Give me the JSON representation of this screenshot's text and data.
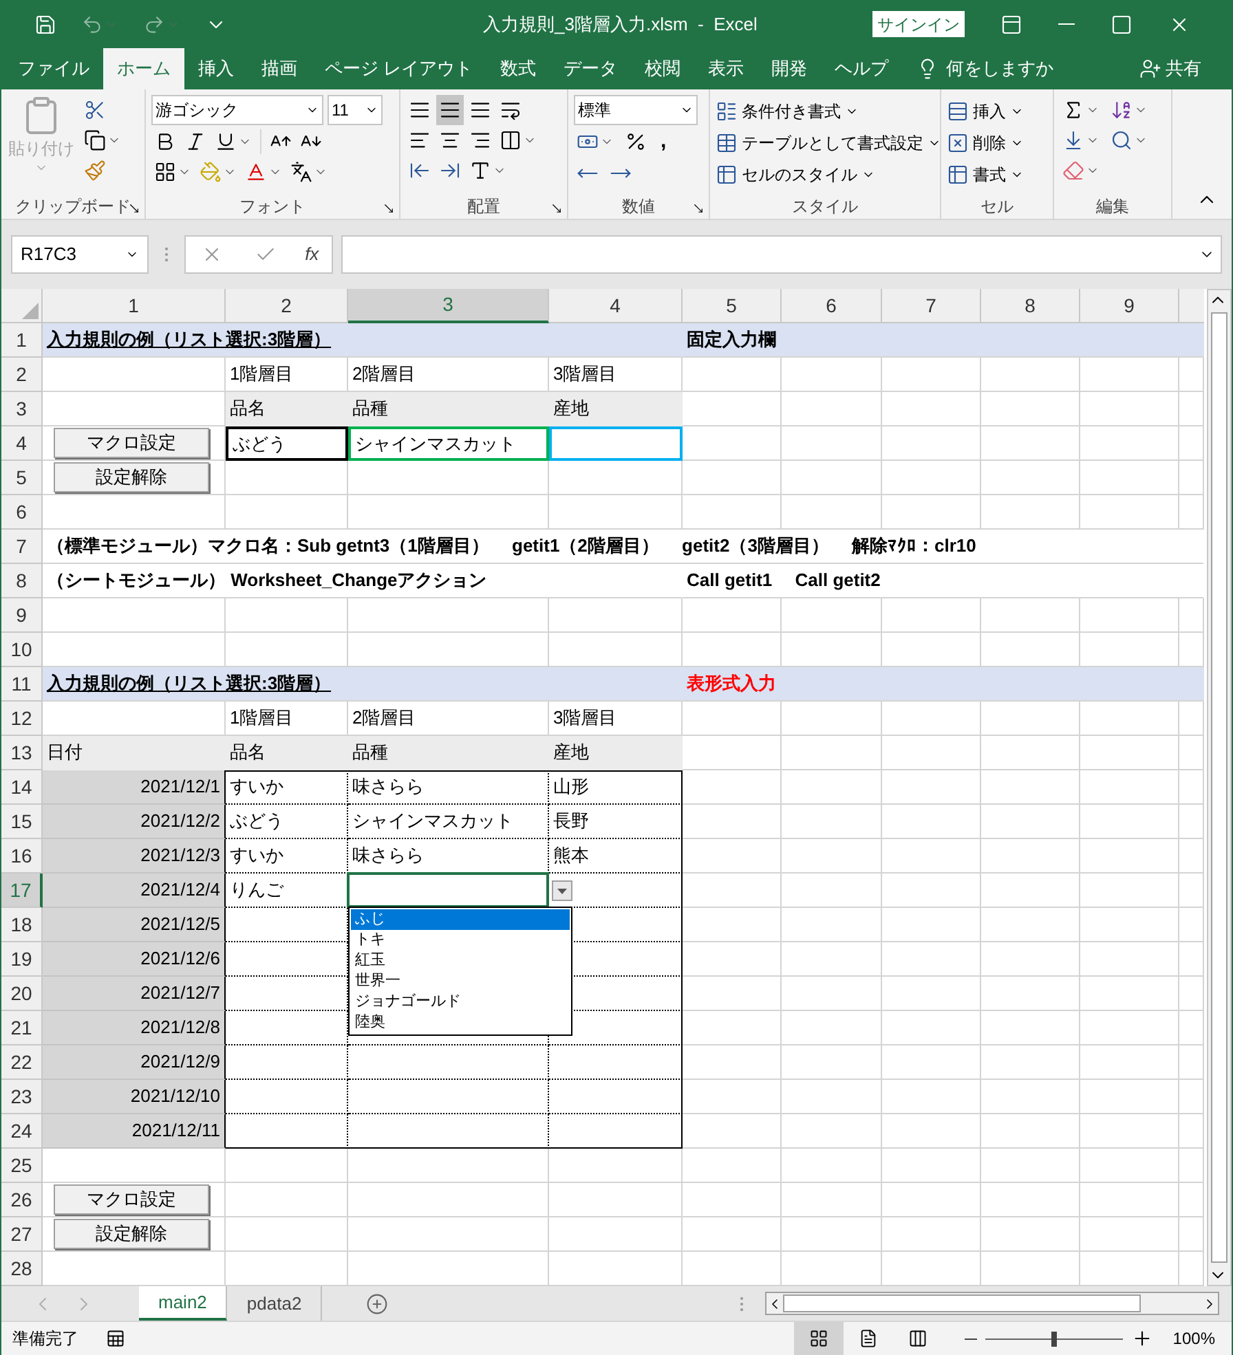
{
  "window": {
    "title": "入力規則_3階層入力.xlsm  -  Excel",
    "sign_in": "サインイン"
  },
  "menu_tabs": [
    {
      "label": "ファイル",
      "selected": false
    },
    {
      "label": "ホーム",
      "selected": true
    },
    {
      "label": "挿入",
      "selected": false
    },
    {
      "label": "描画",
      "selected": false
    },
    {
      "label": "ページ レイアウト",
      "selected": false
    },
    {
      "label": "数式",
      "selected": false
    },
    {
      "label": "データ",
      "selected": false
    },
    {
      "label": "校閲",
      "selected": false
    },
    {
      "label": "表示",
      "selected": false
    },
    {
      "label": "開発",
      "selected": false
    },
    {
      "label": "ヘルプ",
      "selected": false
    }
  ],
  "tell_me": "何をしますか",
  "share": "共有",
  "ribbon": {
    "clipboard": {
      "label": "クリップボード",
      "paste": "貼り付け",
      "paste_disabled": true,
      "launcher": true
    },
    "font": {
      "label": "フォント",
      "font_name": "游ゴシック",
      "font_size": "11",
      "launcher": true
    },
    "alignment": {
      "label": "配置",
      "launcher": true
    },
    "number": {
      "label": "数値",
      "format": "標準",
      "comma": ",",
      "launcher": true
    },
    "styles": {
      "label": "スタイル",
      "items": [
        "条件付き書式",
        "テーブルとして書式設定",
        "セルのスタイル"
      ]
    },
    "cells": {
      "label": "セル",
      "items": [
        "挿入",
        "削除",
        "書式"
      ]
    },
    "editing": {
      "label": "編集"
    }
  },
  "formula_bar": {
    "name_box": "R17C3",
    "fx": "fx"
  },
  "columns": [
    {
      "label": "1",
      "selected": false
    },
    {
      "label": "2",
      "selected": false
    },
    {
      "label": "3",
      "selected": true
    },
    {
      "label": "4",
      "selected": false
    },
    {
      "label": "5",
      "selected": false
    },
    {
      "label": "6",
      "selected": false
    },
    {
      "label": "7",
      "selected": false
    },
    {
      "label": "8",
      "selected": false
    },
    {
      "label": "9",
      "selected": false
    }
  ],
  "rows": [
    {
      "number": "1",
      "band": true,
      "selected": false,
      "cells": [
        {
          "kind": "title",
          "text": "入力規則の例（リスト選択:3階層）"
        },
        null,
        null,
        null,
        {
          "kind": "bold",
          "text": "固定入力欄"
        }
      ]
    },
    {
      "number": "2",
      "band": false,
      "selected": false,
      "cells": [
        null,
        {
          "kind": "text",
          "text": "1階層目"
        },
        {
          "kind": "text",
          "text": "2階層目"
        },
        {
          "kind": "text",
          "text": "3階層目"
        }
      ]
    },
    {
      "number": "3",
      "band": false,
      "selected": false,
      "cells": [
        null,
        {
          "kind": "heading",
          "text": "品名"
        },
        {
          "kind": "heading",
          "text": "品種"
        },
        {
          "kind": "heading",
          "text": "産地"
        }
      ]
    },
    {
      "number": "4",
      "band": false,
      "selected": false,
      "cells": [
        {
          "kind": "button",
          "text": "マクロ設定"
        },
        {
          "kind": "entry",
          "text": "ぶどう",
          "color": "#000000"
        },
        {
          "kind": "entry",
          "text": "シャインマスカット",
          "color": "#00b050"
        },
        {
          "kind": "entry",
          "color": "#00b0f0"
        }
      ]
    },
    {
      "number": "5",
      "band": false,
      "selected": false,
      "cells": [
        {
          "kind": "button",
          "text": "設定解除"
        }
      ]
    },
    {
      "number": "6",
      "band": false,
      "selected": false,
      "cells": []
    },
    {
      "number": "7",
      "band": false,
      "selected": false,
      "cells": [
        {
          "kind": "bold",
          "text": "（標準モジュール）マクロ名：Sub getnt3（1階層目）　 getit1（2階層目）　 getit2（3階層目）　 解除ﾏｸﾛ：clr10"
        }
      ]
    },
    {
      "number": "8",
      "band": false,
      "selected": false,
      "cells": [
        {
          "kind": "bold",
          "text": "（シートモジュール） Worksheet_Changeアクション"
        },
        null,
        null,
        null,
        {
          "kind": "bold",
          "text": "Call getit1　 Call getit2"
        }
      ]
    },
    {
      "number": "9",
      "band": false,
      "selected": false,
      "cells": []
    },
    {
      "number": "10",
      "band": false,
      "selected": false,
      "cells": []
    },
    {
      "number": "11",
      "band": true,
      "selected": false,
      "cells": [
        {
          "kind": "title",
          "text": "入力規則の例（リスト選択:3階層）"
        },
        null,
        null,
        null,
        {
          "kind": "alert",
          "text": "表形式入力"
        }
      ]
    },
    {
      "number": "12",
      "band": false,
      "selected": false,
      "cells": [
        null,
        {
          "kind": "text",
          "text": "1階層目"
        },
        {
          "kind": "text",
          "text": "2階層目"
        },
        {
          "kind": "text",
          "text": "3階層目"
        }
      ]
    },
    {
      "number": "13",
      "band": false,
      "selected": false,
      "cells": [
        {
          "kind": "heading",
          "text": "日付"
        },
        {
          "kind": "heading",
          "text": "品名"
        },
        {
          "kind": "heading",
          "text": "品種"
        },
        {
          "kind": "heading",
          "text": "産地"
        }
      ]
    },
    {
      "number": "14",
      "band": false,
      "selected": false,
      "cells": [
        {
          "kind": "date",
          "text": "2021/12/1"
        },
        {
          "kind": "table",
          "text": "すいか"
        },
        {
          "kind": "table",
          "text": "味さらら"
        },
        {
          "kind": "table",
          "text": "山形"
        }
      ]
    },
    {
      "number": "15",
      "band": false,
      "selected": false,
      "cells": [
        {
          "kind": "date",
          "text": "2021/12/2"
        },
        {
          "kind": "table",
          "text": "ぶどう"
        },
        {
          "kind": "table",
          "text": "シャインマスカット"
        },
        {
          "kind": "table",
          "text": "長野"
        }
      ]
    },
    {
      "number": "16",
      "band": false,
      "selected": false,
      "cells": [
        {
          "kind": "date",
          "text": "2021/12/3"
        },
        {
          "kind": "table",
          "text": "すいか"
        },
        {
          "kind": "table",
          "text": "味さらら"
        },
        {
          "kind": "table",
          "text": "熊本"
        }
      ]
    },
    {
      "number": "17",
      "band": false,
      "selected": true,
      "cells": [
        {
          "kind": "date",
          "text": "2021/12/4"
        },
        {
          "kind": "table",
          "text": "りんご"
        },
        {
          "kind": "active"
        },
        {
          "kind": "table"
        }
      ]
    },
    {
      "number": "18",
      "band": false,
      "selected": false,
      "cells": [
        {
          "kind": "date",
          "text": "2021/12/5"
        },
        {
          "kind": "table"
        },
        {
          "kind": "covered"
        },
        {
          "kind": "table"
        }
      ]
    },
    {
      "number": "19",
      "band": false,
      "selected": false,
      "cells": [
        {
          "kind": "date",
          "text": "2021/12/6"
        },
        {
          "kind": "table"
        },
        {
          "kind": "covered"
        },
        {
          "kind": "table"
        }
      ]
    },
    {
      "number": "20",
      "band": false,
      "selected": false,
      "cells": [
        {
          "kind": "date",
          "text": "2021/12/7"
        },
        {
          "kind": "table"
        },
        {
          "kind": "covered"
        },
        {
          "kind": "table"
        }
      ]
    },
    {
      "number": "21",
      "band": false,
      "selected": false,
      "cells": [
        {
          "kind": "date",
          "text": "2021/12/8"
        },
        {
          "kind": "table"
        },
        {
          "kind": "table"
        },
        {
          "kind": "table"
        }
      ]
    },
    {
      "number": "22",
      "band": false,
      "selected": false,
      "cells": [
        {
          "kind": "date",
          "text": "2021/12/9"
        },
        {
          "kind": "table"
        },
        {
          "kind": "table"
        },
        {
          "kind": "table"
        }
      ]
    },
    {
      "number": "23",
      "band": false,
      "selected": false,
      "cells": [
        {
          "kind": "date",
          "text": "2021/12/10"
        },
        {
          "kind": "table"
        },
        {
          "kind": "table"
        },
        {
          "kind": "table"
        }
      ]
    },
    {
      "number": "24",
      "band": false,
      "selected": false,
      "cells": [
        {
          "kind": "date",
          "text": "2021/12/11"
        },
        {
          "kind": "table"
        },
        {
          "kind": "table"
        },
        {
          "kind": "table"
        }
      ]
    },
    {
      "number": "25",
      "band": false,
      "selected": false,
      "cells": []
    },
    {
      "number": "26",
      "band": false,
      "selected": false,
      "cells": [
        {
          "kind": "button",
          "text": "マクロ設定"
        }
      ]
    },
    {
      "number": "27",
      "band": false,
      "selected": false,
      "cells": [
        {
          "kind": "button",
          "text": "設定解除"
        }
      ]
    },
    {
      "number": "28",
      "band": false,
      "selected": false,
      "cells": []
    }
  ],
  "dropdown": {
    "items": [
      {
        "text": "ふじ",
        "selected": true
      },
      {
        "text": "トキ",
        "selected": false
      },
      {
        "text": "紅玉",
        "selected": false
      },
      {
        "text": "世界一",
        "selected": false
      },
      {
        "text": "ジョナゴールド",
        "selected": false
      },
      {
        "text": "陸奥",
        "selected": false
      }
    ]
  },
  "sheet_tabs": [
    {
      "label": "main2",
      "selected": true
    },
    {
      "label": "pdata2",
      "selected": false
    }
  ],
  "status": {
    "text": "準備完了",
    "views": [
      {
        "kind": "normal",
        "selected": true
      },
      {
        "kind": "page-layout",
        "selected": false
      },
      {
        "kind": "page-break",
        "selected": false
      }
    ],
    "zoom": {
      "level": 0.5
    },
    "zoom_label": "100%"
  }
}
